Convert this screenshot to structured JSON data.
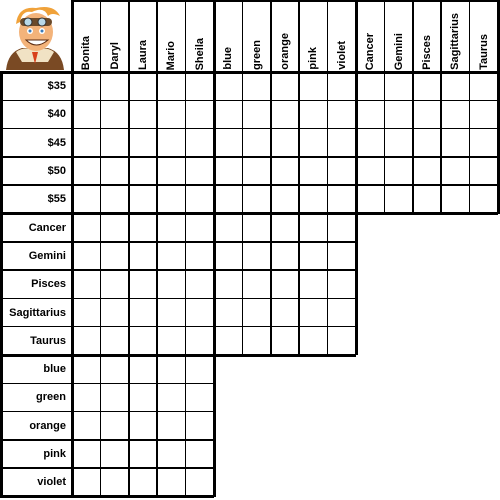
{
  "puzzle": {
    "avatar_icon": "cartoon-pilot-avatar-icon",
    "column_groups": [
      {
        "name": "people",
        "items": [
          "Bonita",
          "Daryl",
          "Laura",
          "Mario",
          "Sheila"
        ]
      },
      {
        "name": "colors",
        "items": [
          "blue",
          "green",
          "orange",
          "pink",
          "violet"
        ]
      },
      {
        "name": "signs",
        "items": [
          "Cancer",
          "Gemini",
          "Pisces",
          "Sagittarius",
          "Taurus"
        ]
      }
    ],
    "row_groups": [
      {
        "name": "prices",
        "items": [
          "$35",
          "$40",
          "$45",
          "$50",
          "$55"
        ],
        "span_columns": 3
      },
      {
        "name": "signs",
        "items": [
          "Cancer",
          "Gemini",
          "Pisces",
          "Sagittarius",
          "Taurus"
        ],
        "span_columns": 2
      },
      {
        "name": "colors",
        "items": [
          "blue",
          "green",
          "orange",
          "pink",
          "violet"
        ],
        "span_columns": 1
      }
    ],
    "colors": {
      "line": "#000000",
      "cell": "#ffffff"
    }
  }
}
